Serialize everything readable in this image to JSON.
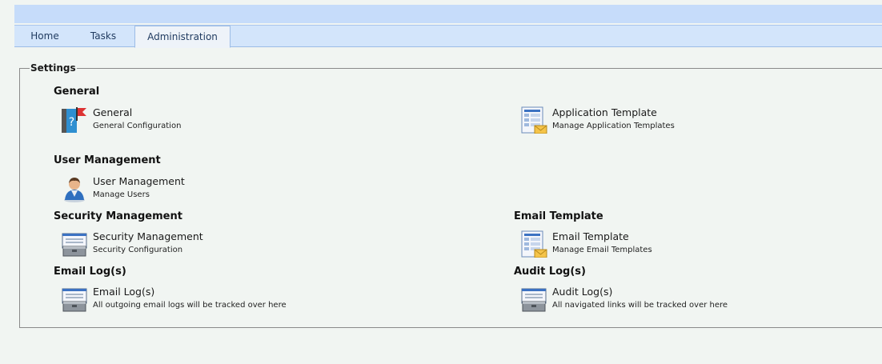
{
  "tabs": [
    {
      "label": "Home"
    },
    {
      "label": "Tasks"
    },
    {
      "label": "Administration",
      "active": true
    }
  ],
  "settings": {
    "legend": "Settings",
    "sections": {
      "general": {
        "title": "General",
        "items": [
          {
            "title": "General",
            "desc": "General Configuration",
            "icon": "help-book-icon"
          },
          {
            "title": "Application Template",
            "desc": "Manage Application Templates",
            "icon": "template-mail-icon"
          }
        ]
      },
      "user_management": {
        "title": "User Management",
        "items": [
          {
            "title": "User Management",
            "desc": "Manage Users",
            "icon": "user-icon"
          }
        ]
      },
      "security_management": {
        "title": "Security Management",
        "items": [
          {
            "title": "Security Management",
            "desc": "Security Configuration",
            "icon": "toolbox-icon"
          }
        ]
      },
      "email_template": {
        "title": "Email Template",
        "items": [
          {
            "title": "Email Template",
            "desc": "Manage Email Templates",
            "icon": "template-mail-icon"
          }
        ]
      },
      "email_logs": {
        "title": "Email Log(s)",
        "items": [
          {
            "title": "Email Log(s)",
            "desc": "All outgoing email logs will be tracked over here",
            "icon": "toolbox-icon"
          }
        ]
      },
      "audit_logs": {
        "title": "Audit Log(s)",
        "items": [
          {
            "title": "Audit Log(s)",
            "desc": "All navigated links will be tracked over here",
            "icon": "toolbox-icon"
          }
        ]
      }
    }
  }
}
